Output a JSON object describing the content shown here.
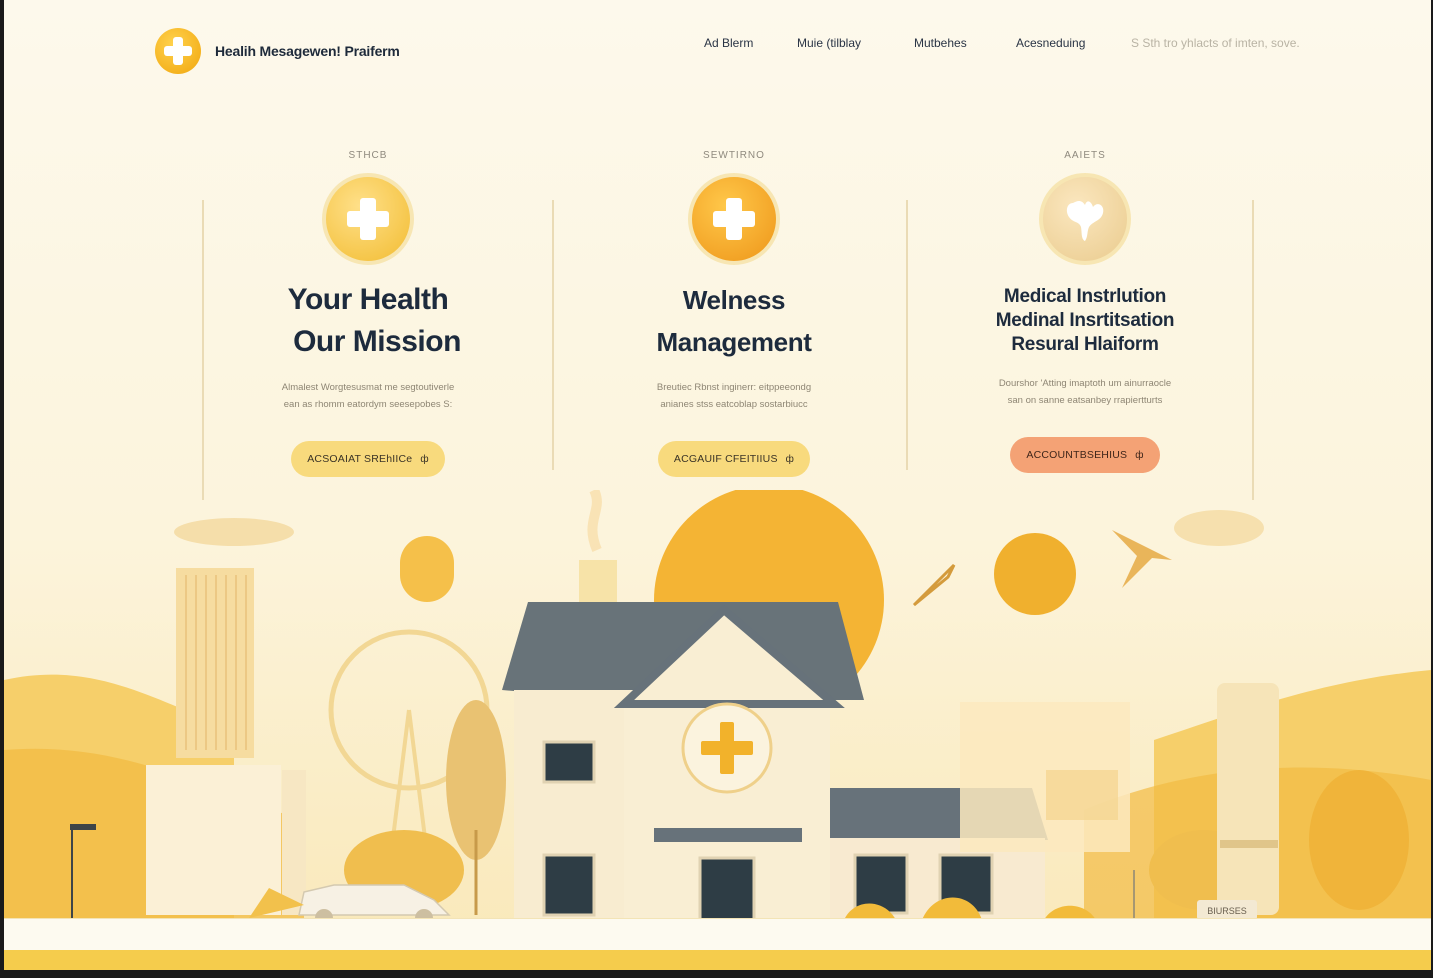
{
  "header": {
    "brand": "Healih Mesagewen! Praiferm",
    "nav": [
      {
        "label": "Ad Blerm"
      },
      {
        "label": "Muie (tilblay"
      },
      {
        "label": "Mutbehes"
      },
      {
        "label": "Acesneduing"
      }
    ],
    "search_placeholder": "S Sth tro yhlacts of  imten, sove."
  },
  "cards": [
    {
      "kicker": "STHCB",
      "heading_lines": [
        "Your Health",
        "Our Mission"
      ],
      "desc_lines": [
        "Almalest Worgtesusmat me segtoutiverle",
        "ean as rhomm eatordym seesepobes S:"
      ],
      "cta": "ACSOAIAT SREhIICe",
      "cta_arrow": "ф",
      "icon": "plus-icon"
    },
    {
      "kicker": "SEWTIRNO",
      "heading_lines": [
        "Welness",
        "Management"
      ],
      "desc_lines": [
        "Breutiec Rbnst inginerr: eitppeeondg",
        "anianes stss eatcoblap sostarbiucc"
      ],
      "cta": "ACGAUIF CFEITIIUS",
      "cta_arrow": "ф",
      "icon": "plus-icon"
    },
    {
      "kicker": "AAIETS",
      "heading_lines": [
        "Medical Instrlution",
        "Medinal Insrtitsation",
        "Resural Hlaiform"
      ],
      "desc_lines": [
        "Dourshor 'Atting imaptoth um ainurraocle",
        "san on sanne eatsanbey rrapiertturts"
      ],
      "cta": "ACCOUNTBSEHIUS",
      "cta_arrow": "ф",
      "icon": "tooth-icon"
    }
  ],
  "illustration": {
    "sign_text": "BIURSES",
    "colors": {
      "accent": "#f5b320",
      "sun": "#f4b434",
      "roof": "#68737a",
      "house": "#f7e8c8",
      "orange_cta": "#f4a275",
      "yellow_cta": "#f8da7d"
    }
  }
}
